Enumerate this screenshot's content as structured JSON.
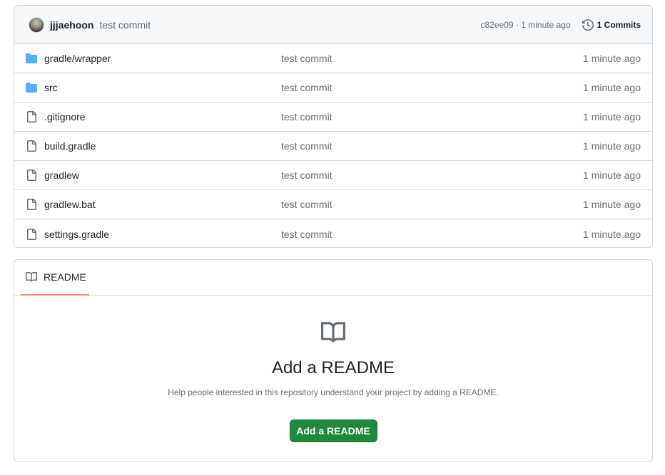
{
  "latest_commit": {
    "author": "jjjaehoon",
    "message": "test commit",
    "sha_time": "c82ee09 · 1 minute ago",
    "commits_label": "1 Commits"
  },
  "files": [
    {
      "name": "gradle/wrapper",
      "type": "folder",
      "commit": "test commit",
      "age": "1 minute ago"
    },
    {
      "name": "src",
      "type": "folder",
      "commit": "test commit",
      "age": "1 minute ago"
    },
    {
      "name": ".gitignore",
      "type": "file",
      "commit": "test commit",
      "age": "1 minute ago"
    },
    {
      "name": "build.gradle",
      "type": "file",
      "commit": "test commit",
      "age": "1 minute ago"
    },
    {
      "name": "gradlew",
      "type": "file",
      "commit": "test commit",
      "age": "1 minute ago"
    },
    {
      "name": "gradlew.bat",
      "type": "file",
      "commit": "test commit",
      "age": "1 minute ago"
    },
    {
      "name": "settings.gradle",
      "type": "file",
      "commit": "test commit",
      "age": "1 minute ago"
    }
  ],
  "readme": {
    "tab_label": "README",
    "title": "Add a README",
    "description": "Help people interested in this repository understand your project by adding a README.",
    "button_label": "Add a README"
  },
  "icons": {
    "folder": "folder-icon",
    "file": "file-icon",
    "history": "history-icon",
    "book": "book-icon"
  },
  "colors": {
    "folder": "#54aeff",
    "accent_tab": "#fd8c73",
    "primary_button": "#1f883d"
  }
}
